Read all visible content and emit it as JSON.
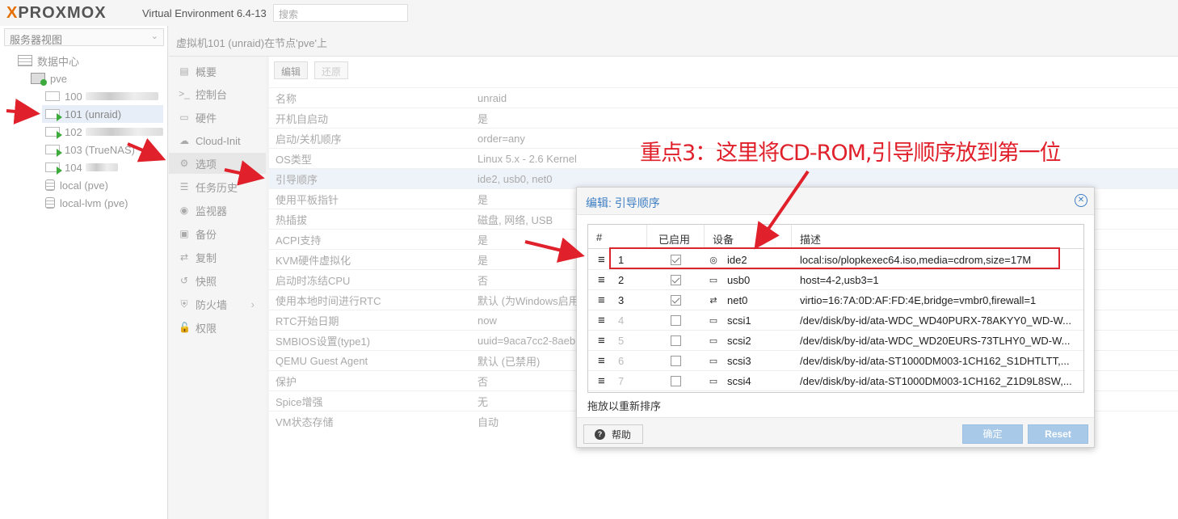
{
  "app": {
    "logo_text": "PROXMOX",
    "version": "Virtual Environment 6.4-13",
    "search_placeholder": "搜索"
  },
  "left": {
    "view_select": "服务器视图",
    "tree": [
      {
        "label": "数据中心"
      },
      {
        "label": "pve"
      },
      {
        "label": "100"
      },
      {
        "label": "101 (unraid)"
      },
      {
        "label": "102"
      },
      {
        "label": "103 (TrueNAS)"
      },
      {
        "label": "104"
      },
      {
        "label": "local (pve)"
      },
      {
        "label": "local-lvm (pve)"
      }
    ]
  },
  "header": {
    "title": "虚拟机101 (unraid)在节点'pve'上"
  },
  "menu": [
    {
      "label": "概要",
      "icon": "book-icon"
    },
    {
      "label": "控制台",
      "icon": "terminal-icon"
    },
    {
      "label": "硬件",
      "icon": "monitor-icon"
    },
    {
      "label": "Cloud-Init",
      "icon": "cloud-icon"
    },
    {
      "label": "选项",
      "icon": "gear-icon"
    },
    {
      "label": "任务历史",
      "icon": "list-icon"
    },
    {
      "label": "监视器",
      "icon": "eye-icon"
    },
    {
      "label": "备份",
      "icon": "floppy-icon"
    },
    {
      "label": "复制",
      "icon": "retweet-icon"
    },
    {
      "label": "快照",
      "icon": "history-icon"
    },
    {
      "label": "防火墙",
      "icon": "shield-icon"
    },
    {
      "label": "权限",
      "icon": "unlock-icon"
    }
  ],
  "toolbar": {
    "edit": "编辑",
    "revert": "还原"
  },
  "properties": [
    {
      "key": "名称",
      "value": "unraid"
    },
    {
      "key": "开机自启动",
      "value": "是"
    },
    {
      "key": "启动/关机顺序",
      "value": "order=any"
    },
    {
      "key": "OS类型",
      "value": "Linux 5.x - 2.6 Kernel"
    },
    {
      "key": "引导顺序",
      "value": "ide2, usb0, net0"
    },
    {
      "key": "使用平板指针",
      "value": "是"
    },
    {
      "key": "热插拔",
      "value": "磁盘, 网络, USB"
    },
    {
      "key": "ACPI支持",
      "value": "是"
    },
    {
      "key": "KVM硬件虚拟化",
      "value": "是"
    },
    {
      "key": "启动时冻结CPU",
      "value": "否"
    },
    {
      "key": "使用本地时间进行RTC",
      "value": "默认 (为Windows启用)"
    },
    {
      "key": "RTC开始日期",
      "value": "now"
    },
    {
      "key": "SMBIOS设置(type1)",
      "value": "uuid=9aca7cc2-8aeb"
    },
    {
      "key": "QEMU Guest Agent",
      "value": "默认 (已禁用)"
    },
    {
      "key": "保护",
      "value": "否"
    },
    {
      "key": "Spice增强",
      "value": "无"
    },
    {
      "key": "VM状态存储",
      "value": "自动"
    }
  ],
  "annotation": "重点3：这里将CD-ROM,引导顺序放到第一位",
  "dialog": {
    "title": "编辑: 引导顺序",
    "columns": {
      "num": "#",
      "enabled": "已启用",
      "device": "设备",
      "desc": "描述"
    },
    "rows": [
      {
        "num": "1",
        "enabled": true,
        "icon": "cdrom-icon",
        "device": "ide2",
        "desc": "local:iso/plopkexec64.iso,media=cdrom,size=17M"
      },
      {
        "num": "2",
        "enabled": true,
        "icon": "hdd-icon",
        "device": "usb0",
        "desc": "host=4-2,usb3=1"
      },
      {
        "num": "3",
        "enabled": true,
        "icon": "exchange-icon",
        "device": "net0",
        "desc": "virtio=16:7A:0D:AF:FD:4E,bridge=vmbr0,firewall=1"
      },
      {
        "num": "4",
        "enabled": false,
        "icon": "hdd-icon",
        "device": "scsi1",
        "desc": "/dev/disk/by-id/ata-WDC_WD40PURX-78AKYY0_WD-W..."
      },
      {
        "num": "5",
        "enabled": false,
        "icon": "hdd-icon",
        "device": "scsi2",
        "desc": "/dev/disk/by-id/ata-WDC_WD20EURS-73TLHY0_WD-W..."
      },
      {
        "num": "6",
        "enabled": false,
        "icon": "hdd-icon",
        "device": "scsi3",
        "desc": "/dev/disk/by-id/ata-ST1000DM003-1CH162_S1DHTLTT,..."
      },
      {
        "num": "7",
        "enabled": false,
        "icon": "hdd-icon",
        "device": "scsi4",
        "desc": "/dev/disk/by-id/ata-ST1000DM003-1CH162_Z1D9L8SW,..."
      }
    ],
    "hint": "拖放以重新排序",
    "help": "帮助",
    "ok": "确定",
    "reset": "Reset"
  }
}
